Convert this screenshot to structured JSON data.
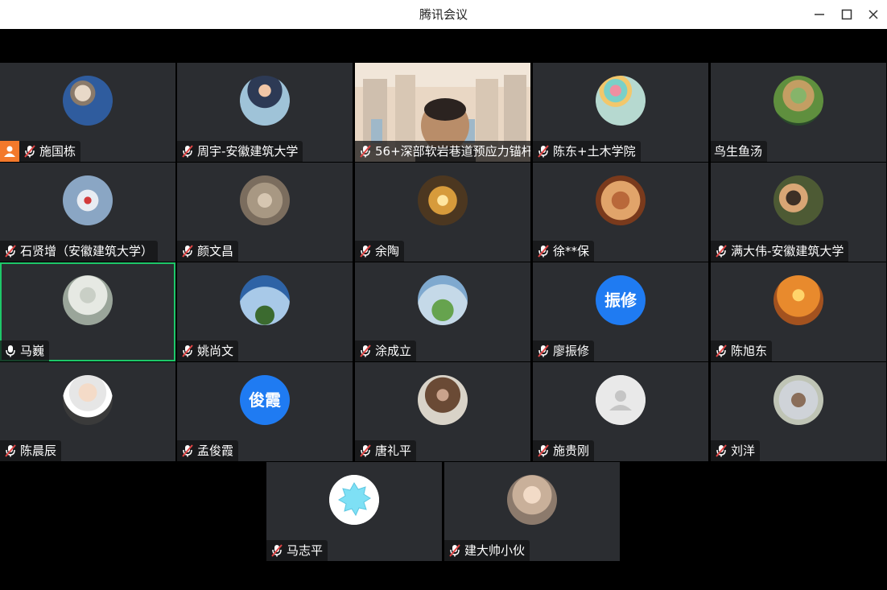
{
  "window": {
    "title": "腾讯会议"
  },
  "participants": [
    {
      "name": "施国栋",
      "host": true,
      "mic": "muted",
      "avatar": "photo"
    },
    {
      "name": "周宇-安徽建筑大学",
      "mic": "muted",
      "avatar": "photo"
    },
    {
      "name": "56+深部软岩巷道预应力锚杆",
      "mic": "muted",
      "avatar": "video"
    },
    {
      "name": "陈东+土木学院",
      "mic": "muted",
      "avatar": "photo"
    },
    {
      "name": "鸟生鱼汤",
      "mic": "none",
      "avatar": "photo"
    },
    {
      "name": "石贤增（安徽建筑大学）",
      "mic": "muted",
      "avatar": "photo"
    },
    {
      "name": "颜文昌",
      "mic": "muted",
      "avatar": "photo"
    },
    {
      "name": "余陶",
      "mic": "muted",
      "avatar": "photo"
    },
    {
      "name": "徐**保",
      "mic": "muted",
      "avatar": "photo"
    },
    {
      "name": "满大伟-安徽建筑大学",
      "mic": "muted",
      "avatar": "photo"
    },
    {
      "name": "马巍",
      "mic": "on",
      "avatar": "photo",
      "active": true
    },
    {
      "name": "姚尚文",
      "mic": "muted",
      "avatar": "photo"
    },
    {
      "name": "涂成立",
      "mic": "muted",
      "avatar": "photo"
    },
    {
      "name": "廖振修",
      "mic": "muted",
      "avatar": "text",
      "avatar_text": "振修"
    },
    {
      "name": "陈旭东",
      "mic": "muted",
      "avatar": "photo"
    },
    {
      "name": "陈晨辰",
      "mic": "muted",
      "avatar": "photo"
    },
    {
      "name": "孟俊霞",
      "mic": "muted",
      "avatar": "text",
      "avatar_text": "俊霞"
    },
    {
      "name": "唐礼平",
      "mic": "muted",
      "avatar": "photo"
    },
    {
      "name": "施贵刚",
      "mic": "muted",
      "avatar": "default"
    },
    {
      "name": "刘洋",
      "mic": "muted",
      "avatar": "photo"
    },
    {
      "name": "马志平",
      "mic": "muted",
      "avatar": "snowflake"
    },
    {
      "name": "建大帅小伙",
      "mic": "muted",
      "avatar": "photo"
    }
  ],
  "colors": {
    "tile_bg": "#2b2d31",
    "active_border": "#1ec769",
    "host_badge": "#f3792b",
    "text_avatar": "#1f7bf2"
  }
}
